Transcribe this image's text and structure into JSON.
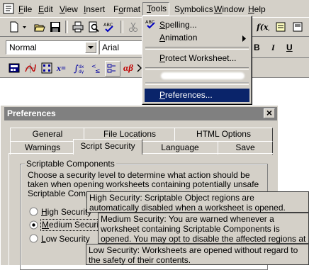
{
  "menubar": {
    "items": [
      {
        "label": "File",
        "key": "F",
        "rest": "ile"
      },
      {
        "label": "Edit",
        "key": "E",
        "rest": "dit"
      },
      {
        "label": "View",
        "key": "V",
        "rest": "iew"
      },
      {
        "label": "Insert",
        "key": "I",
        "rest": "nsert"
      },
      {
        "label": "Format",
        "key": "o",
        "pre": "F",
        "rest": "rmat"
      },
      {
        "label": "Tools",
        "key": "T",
        "rest": "ools"
      },
      {
        "label": "Symbolics",
        "key": "y",
        "pre": "S",
        "rest": "mbolics"
      },
      {
        "label": "Window",
        "key": "W",
        "rest": "indow"
      },
      {
        "label": "Help",
        "key": "H",
        "rest": "elp"
      }
    ]
  },
  "format_toolbar": {
    "style_value": "Normal",
    "font_value": "Arial",
    "bold": "B",
    "italic": "I",
    "underline": "U"
  },
  "math_toolbar": {
    "x_equals": "x=",
    "alpha_beta": "αβ"
  },
  "tools_menu": {
    "items": [
      {
        "label": "Spelling...",
        "key": "S",
        "rest": "pelling..."
      },
      {
        "label": "Animation",
        "key": "A",
        "rest": "nimation"
      },
      {
        "label": "Protect Worksheet...",
        "key": "P",
        "rest": "rotect Worksheet..."
      },
      {
        "label": "Preferences...",
        "key": "P",
        "rest": "references..."
      }
    ],
    "spell_glyph": "ABC"
  },
  "dialog": {
    "title": "Preferences",
    "close_glyph": "×",
    "tabs_back": [
      "General",
      "File Locations",
      "HTML Options"
    ],
    "tabs_front": [
      "Warnings",
      "Script Security",
      "Language",
      "Save"
    ],
    "active_tab": "Script Security",
    "group_title": "Scriptable Components",
    "description": "Choose a security level to determine what action should be taken when opening worksheets containing potentially unsafe Scriptable Components:",
    "options": [
      {
        "label": "High Security",
        "key": "H",
        "rest": "igh Security",
        "selected": false
      },
      {
        "label": "Medium Security",
        "key": "M",
        "rest": "edium Security",
        "selected": true
      },
      {
        "label": "Low Security",
        "key": "L",
        "rest": "ow Security",
        "selected": false
      }
    ]
  },
  "tooltips": {
    "high": "High Security:  Scriptable Object regions are automatically disabled when a worksheet is opened.",
    "medium": "Medium Security:  You are warned whenever a worksheet containing Scriptable Components is opened.  You may opt to disable the affected regions at that time.",
    "low": "Low Security:  Worksheets are opened without regard to the safety of their contents."
  },
  "colors": {
    "face": "#d4d0c8",
    "highlight": "#0a246a",
    "title_inactive": "#808080"
  }
}
